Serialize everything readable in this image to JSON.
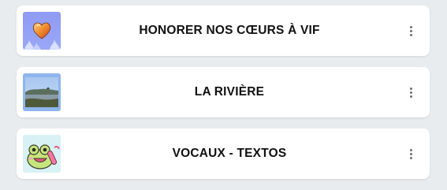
{
  "playlists": [
    {
      "title": "HONORER NOS CŒURS À VIF",
      "thumbnail_icon": "flaming-heart-image"
    },
    {
      "title": "LA RIVIÈRE",
      "thumbnail_icon": "river-landscape-image"
    },
    {
      "title": "VOCAUX - TEXTOS",
      "thumbnail_icon": "frog-phone-image"
    }
  ],
  "colors": {
    "background": "#e9ecef",
    "card": "#ffffff",
    "text": "#111111",
    "more_dots": "#6b6f75"
  }
}
